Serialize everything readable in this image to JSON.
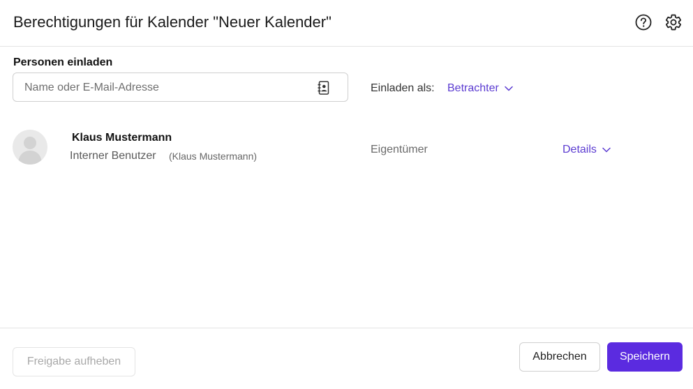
{
  "header": {
    "title": "Berechtigungen für Kalender \"Neuer Kalender\"",
    "icons": [
      "help-icon",
      "gear-icon"
    ]
  },
  "invite": {
    "section_label": "Personen einladen",
    "search_placeholder": "Name oder E-Mail-Adresse",
    "search_value": "",
    "invite_as_label": "Einladen als:",
    "role_value": "Betrachter"
  },
  "users": [
    {
      "name": "Klaus Mustermann",
      "type": "Interner Benutzer",
      "login": "(Klaus Mustermann)",
      "role": "Eigentümer",
      "details_label": "Details"
    }
  ],
  "footer": {
    "unshare_label": "Freigabe aufheben",
    "cancel_label": "Abbrechen",
    "save_label": "Speichern"
  },
  "colors": {
    "accent": "#5b2be0",
    "link": "#5b3bd1",
    "border": "#e3e3e3",
    "avatar_bg": "#e9e9e9"
  }
}
